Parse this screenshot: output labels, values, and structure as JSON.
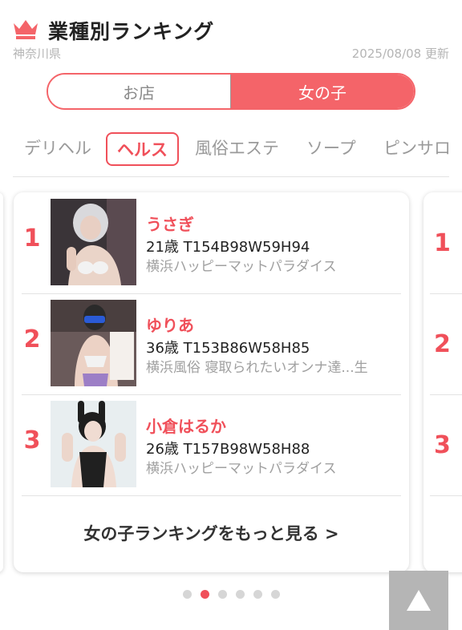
{
  "header": {
    "title": "業種別ランキング",
    "prefecture": "神奈川県",
    "updated": "2025/08/08 更新",
    "accent_color": "#f46469",
    "icon": "crown-icon"
  },
  "segment": {
    "options": [
      "お店",
      "女の子"
    ],
    "selected": "女の子"
  },
  "tabs": [
    {
      "label": "デリヘル"
    },
    {
      "label": "ヘルス"
    },
    {
      "label": "風俗エステ"
    },
    {
      "label": "ソープ"
    },
    {
      "label": "ピンサロ"
    }
  ],
  "active_tab": "ヘルス",
  "ranking": [
    {
      "rank": "1",
      "name": "うさぎ",
      "spec": "21歳 T154B98W59H94",
      "shop": "横浜ハッピーマットパラダイス"
    },
    {
      "rank": "2",
      "name": "ゆりあ",
      "spec": "36歳 T153B86W58H85",
      "shop": "横浜風俗 寝取られたいオンナ達...生"
    },
    {
      "rank": "3",
      "name": "小倉はるか",
      "spec": "26歳 T157B98W58H88",
      "shop": "横浜ハッピーマットパラダイス"
    }
  ],
  "peek_ranks": [
    "1",
    "2",
    "3"
  ],
  "more_link": "女の子ランキングをもっと見る >",
  "pagination": {
    "count": 6,
    "active_index": 1
  },
  "scroll_top_icon": "up-arrow-icon"
}
